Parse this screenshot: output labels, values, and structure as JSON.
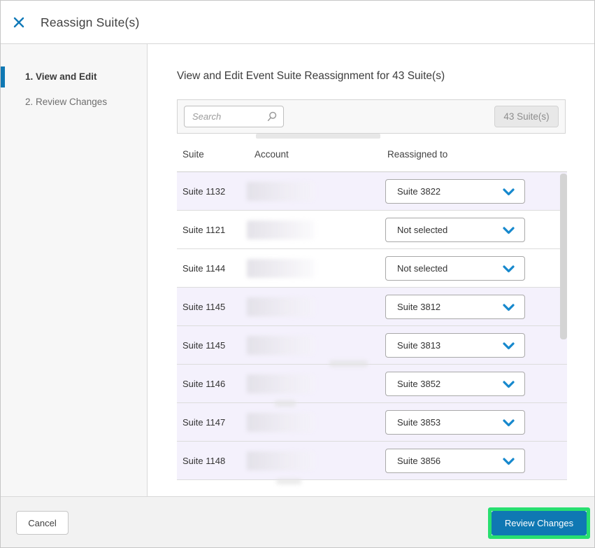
{
  "modal": {
    "title": "Reassign Suite(s)"
  },
  "steps": [
    {
      "label": "1. View and Edit",
      "active": true
    },
    {
      "label": "2. Review Changes",
      "active": false
    }
  ],
  "main": {
    "section_title": "View and Edit Event Suite Reassignment for 43 Suite(s)",
    "toolbar": {
      "search_placeholder": "Search",
      "search_icon": "magnifier-icon",
      "count_label": "43 Suite(s)"
    },
    "table": {
      "columns": [
        "Suite",
        "Account",
        "Reassigned to"
      ],
      "rows": [
        {
          "suite": "Suite 1132",
          "reassigned_to": "Suite 3822",
          "highlighted": true
        },
        {
          "suite": "Suite 1121",
          "reassigned_to": "Not selected",
          "highlighted": false
        },
        {
          "suite": "Suite 1144",
          "reassigned_to": "Not selected",
          "highlighted": false
        },
        {
          "suite": "Suite 1145",
          "reassigned_to": "Suite 3812",
          "highlighted": true
        },
        {
          "suite": "Suite 1145",
          "reassigned_to": "Suite 3813",
          "highlighted": true
        },
        {
          "suite": "Suite 1146",
          "reassigned_to": "Suite 3852",
          "highlighted": true
        },
        {
          "suite": "Suite 1147",
          "reassigned_to": "Suite 3853",
          "highlighted": true
        },
        {
          "suite": "Suite 1148",
          "reassigned_to": "Suite 3856",
          "highlighted": true
        }
      ]
    }
  },
  "footer": {
    "cancel_label": "Cancel",
    "review_label": "Review Changes"
  },
  "colors": {
    "accent_blue": "#0f78b3",
    "chevron_blue": "#1688cd",
    "highlight_green": "#28df70",
    "row_highlight": "#f4f1fc"
  }
}
